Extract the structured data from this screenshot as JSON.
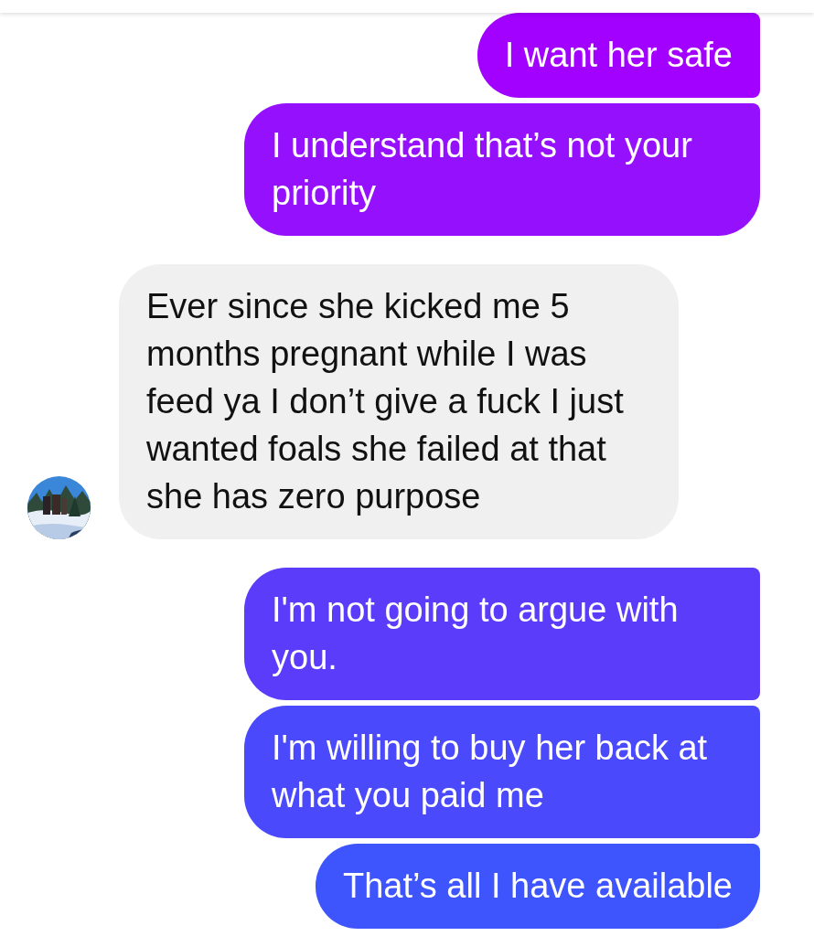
{
  "messages": [
    {
      "kind": "outgoing",
      "text": "I want her safe",
      "color": "#a200ff"
    },
    {
      "kind": "outgoing",
      "text": "I understand that’s not your priority",
      "color": "#9511fd"
    },
    {
      "kind": "incoming",
      "text": "Ever since she kicked me 5 months pregnant while I was feed ya I don’t give a fuck I just wanted foals she failed at that she has zero purpose"
    },
    {
      "kind": "outgoing",
      "text": "I'm not going to argue with you.",
      "color": "#5a3cfa"
    },
    {
      "kind": "outgoing",
      "text": "I'm willing to buy her back at what you paid me",
      "color": "#4a49fb"
    },
    {
      "kind": "outgoing",
      "text": "That’s all I have available",
      "color": "#3e54fd"
    }
  ]
}
